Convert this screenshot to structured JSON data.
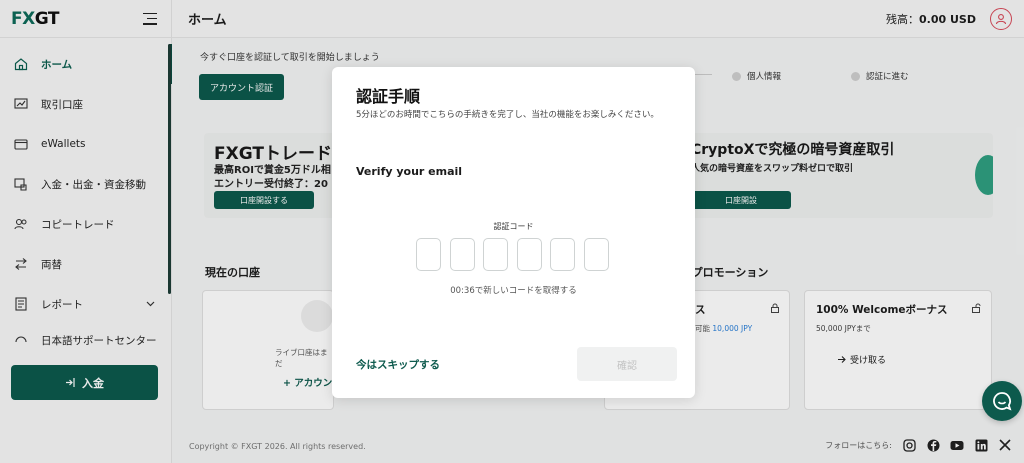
{
  "brand": {
    "logo_text": "FXGT",
    "accent": "#0d5a4d"
  },
  "header": {
    "title": "ホーム",
    "balance_label": "残高：",
    "balance_value": "0.00 USD"
  },
  "sidebar": {
    "items": [
      {
        "label": "ホーム",
        "icon": "home-icon",
        "active": true
      },
      {
        "label": "取引口座",
        "icon": "trading-account-icon"
      },
      {
        "label": "eWallets",
        "icon": "wallet-icon"
      },
      {
        "label": "入金・出金・資金移動",
        "icon": "fund-transfer-icon"
      },
      {
        "label": "コピートレード",
        "icon": "copy-trade-icon"
      },
      {
        "label": "両替",
        "icon": "exchange-icon"
      },
      {
        "label": "レポート",
        "icon": "report-icon"
      },
      {
        "label": "日本語サポートセンター",
        "icon": "support-icon"
      }
    ],
    "deposit_button": "入金"
  },
  "main": {
    "verify_prompt": "今すぐ口座を認証して取引を開始しましょう",
    "verify_button": "アカウント認証",
    "steps": [
      "個人情報",
      "認証に進む"
    ],
    "promo_left": {
      "title": "FXGTトレード",
      "line1": "最高ROIで賞金5万ドル相",
      "line2": "エントリー受付終了：20",
      "button": "口座開設する"
    },
    "promo_right": {
      "title": "CryptoXで究極の暗号資産取引",
      "line1": "人気の暗号資産をスワップ料ゼロで取引",
      "button": "口座開設"
    },
    "section_accounts": "現在の口座",
    "live_account_text": "ライブ口座はまだ",
    "add_account": "アカウン",
    "section_bonus": "&プロモーション",
    "bonus_left": {
      "title": "ス",
      "line": "可能",
      "amount": "10,000 JPY"
    },
    "bonus_right": {
      "title": "100% Welcomeボーナス",
      "line": "50,000 JPYまで",
      "action": "受け取る"
    }
  },
  "footer": {
    "copyright": "Copyright © FXGT 2026. All rights reserved.",
    "follow": "フォローはこちら:",
    "socials": [
      "instagram-icon",
      "facebook-icon",
      "youtube-icon",
      "linkedin-icon",
      "x-icon"
    ]
  },
  "modal": {
    "title": "認証手順",
    "description": "5分ほどのお時間でこちらの手続きを完了し、当社の機能をお楽しみください。",
    "verify_email": "Verify your email",
    "code_label": "認証コード",
    "code_length": 6,
    "resend": "00:36で新しいコードを取得する",
    "skip": "今はスキップする",
    "confirm": "確認"
  }
}
